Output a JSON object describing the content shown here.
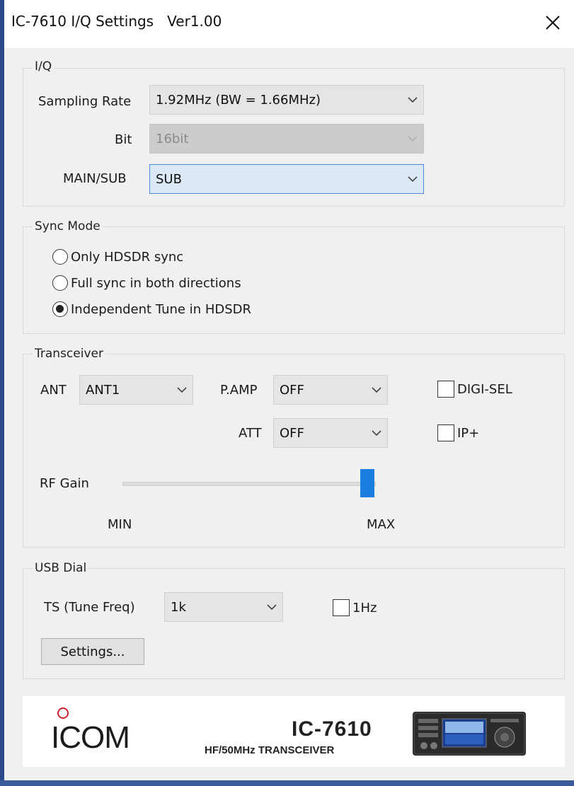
{
  "window": {
    "title": "IC-7610 I/Q Settings   Ver1.00"
  },
  "iq": {
    "group_label": "I/Q",
    "sampling_rate_label": "Sampling Rate",
    "sampling_rate_value": "1.92MHz (BW = 1.66MHz)",
    "bit_label": "Bit",
    "bit_value": "16bit",
    "main_sub_label": "MAIN/SUB",
    "main_sub_value": "SUB"
  },
  "sync_mode": {
    "group_label": "Sync Mode",
    "options": [
      {
        "label": "Only HDSDR sync",
        "checked": false
      },
      {
        "label": "Full sync in both directions",
        "checked": false
      },
      {
        "label": "Independent Tune in HDSDR",
        "checked": true
      }
    ]
  },
  "transceiver": {
    "group_label": "Transceiver",
    "ant_label": "ANT",
    "ant_value": "ANT1",
    "pamp_label": "P.AMP",
    "pamp_value": "OFF",
    "att_label": "ATT",
    "att_value": "OFF",
    "digisel_label": "DIGI-SEL",
    "digisel_checked": false,
    "ipplus_label": "IP+",
    "ipplus_checked": false,
    "rf_gain_label": "RF Gain",
    "rf_gain_min_label": "MIN",
    "rf_gain_max_label": "MAX",
    "rf_gain_level": 1.0
  },
  "usb_dial": {
    "group_label": "USB Dial",
    "ts_label": "TS (Tune Freq)",
    "ts_value": "1k",
    "onehz_label": "1Hz",
    "onehz_checked": false,
    "settings_button": "Settings..."
  },
  "banner": {
    "brand": "ICOM",
    "model": "IC-7610",
    "subtitle": "HF/50MHz TRANSCEIVER"
  },
  "colors": {
    "accent": "#1a7ee0",
    "brand_red": "#d0202a",
    "focus_bg": "#dbe9f6"
  }
}
